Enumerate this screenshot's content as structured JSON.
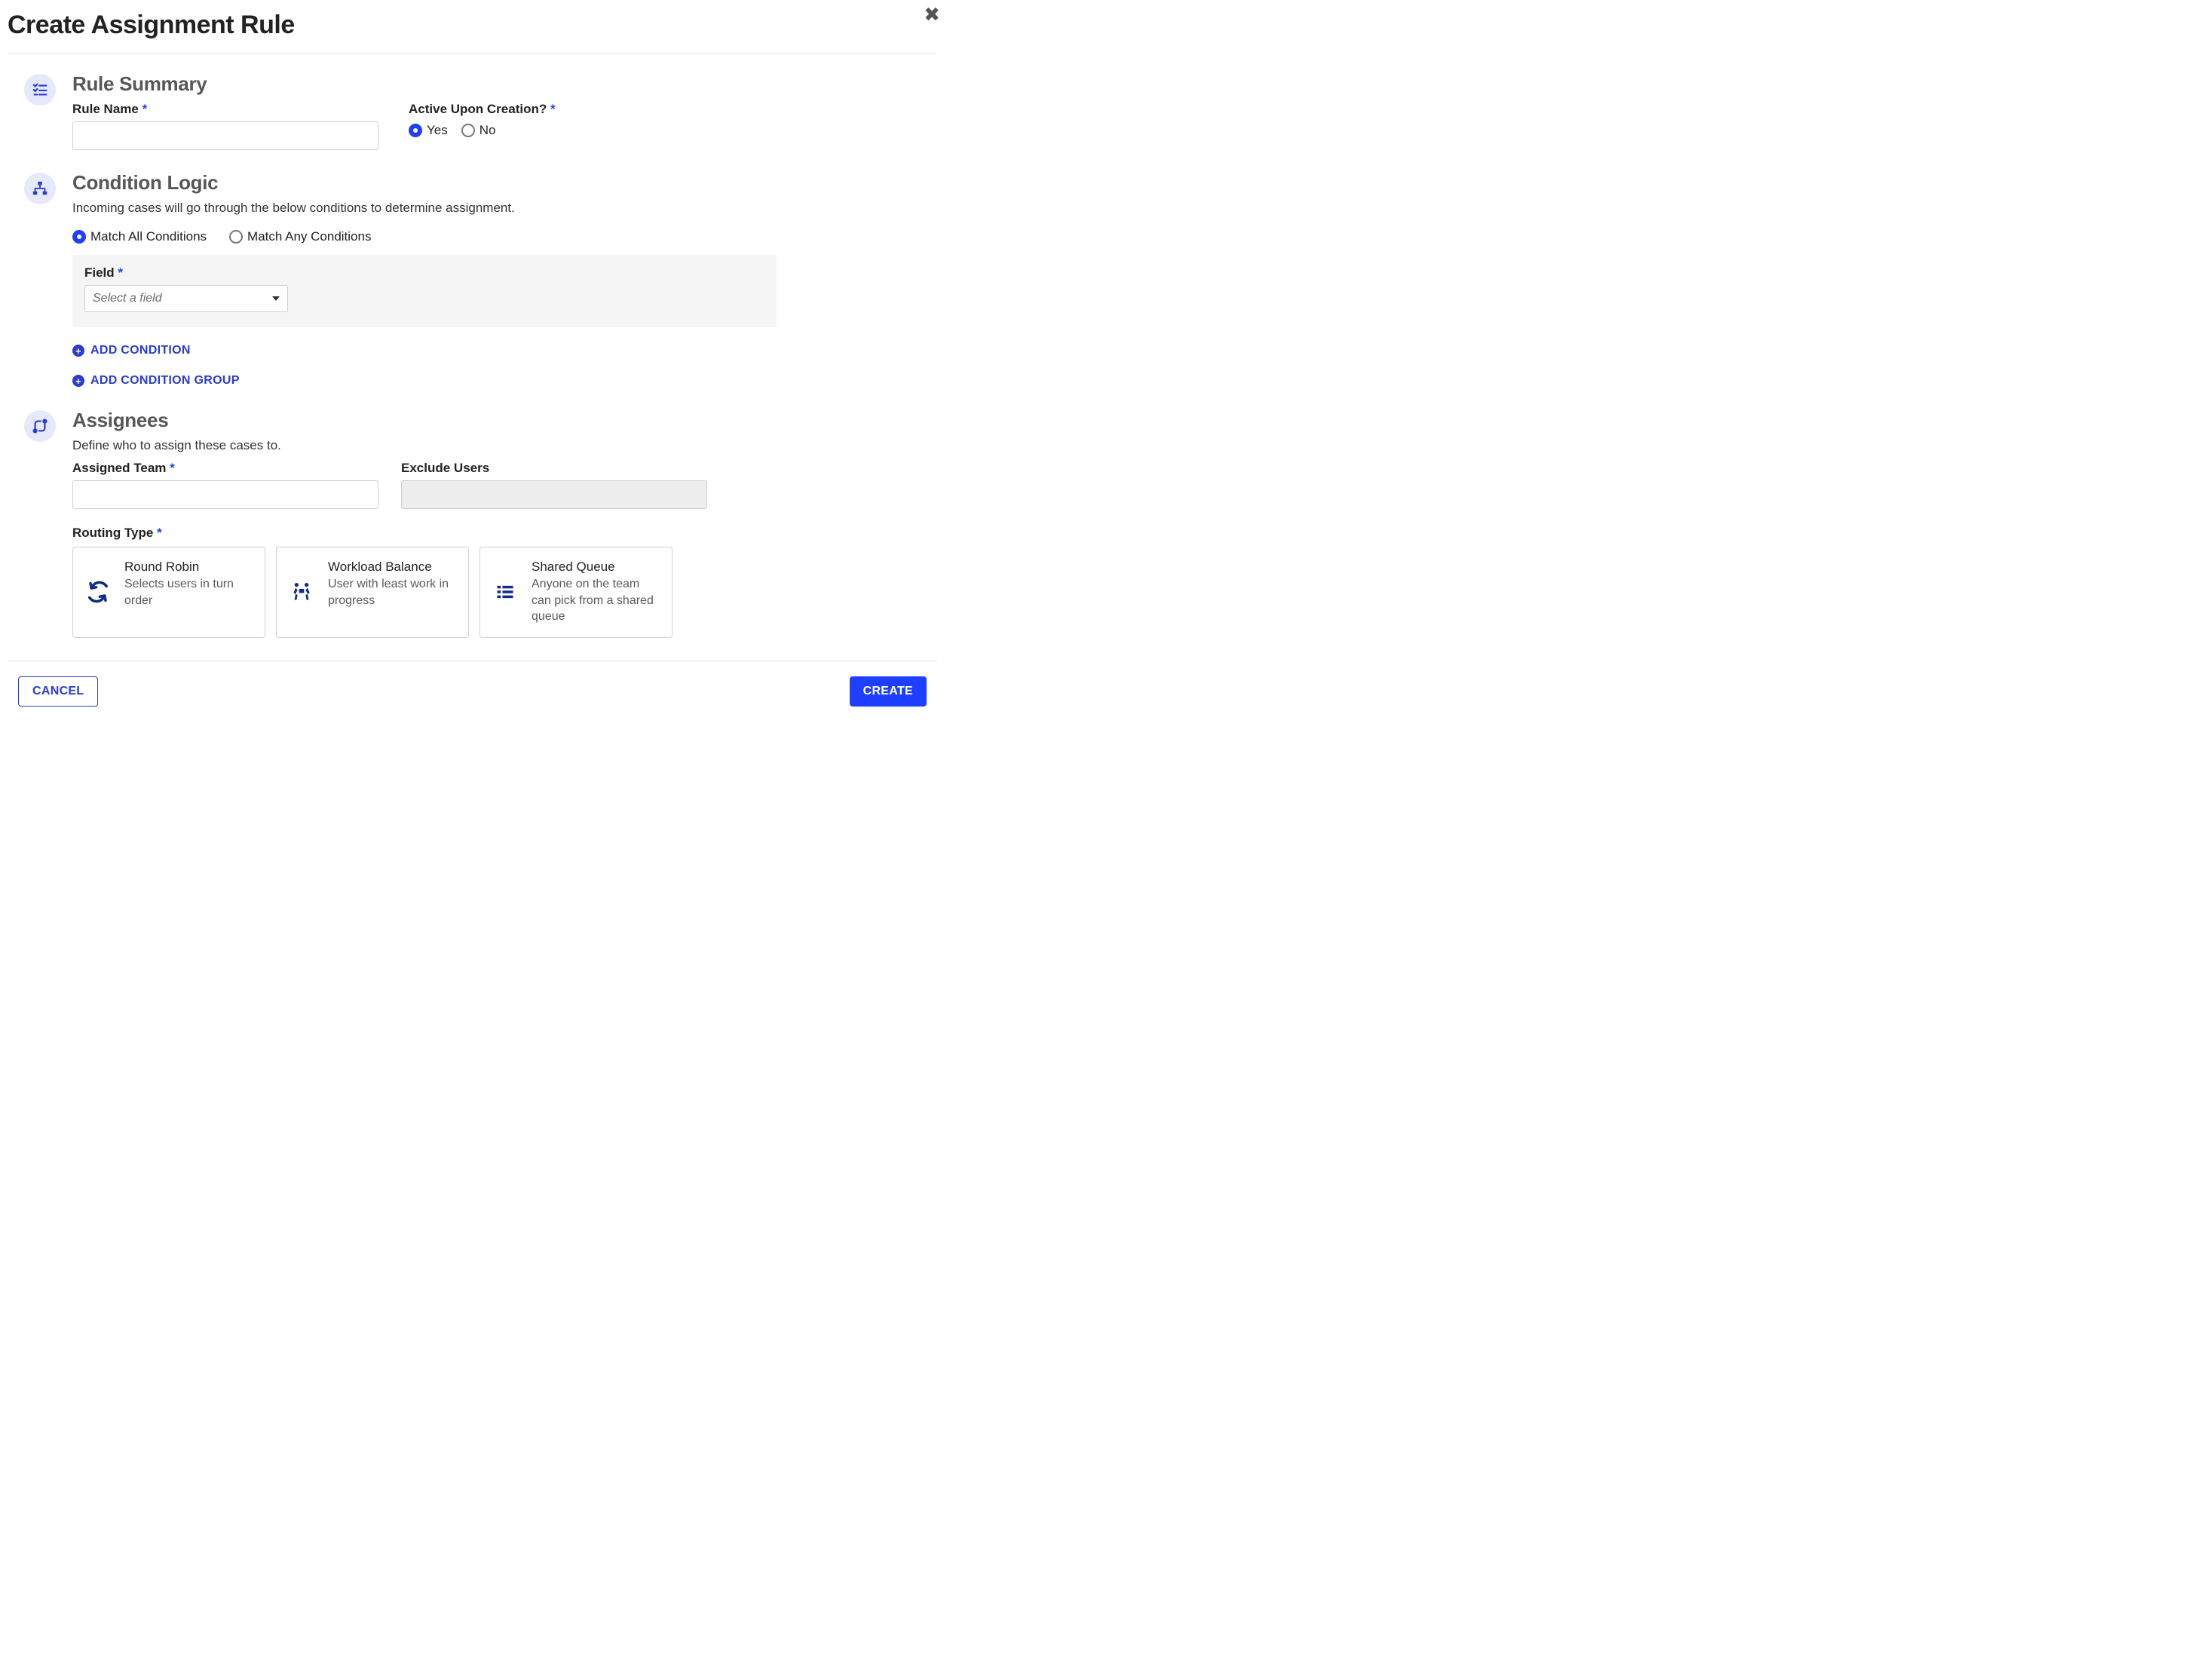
{
  "modal": {
    "title": "Create Assignment Rule"
  },
  "summary": {
    "heading": "Rule Summary",
    "rule_name_label": "Rule Name",
    "rule_name_value": "",
    "active_label": "Active Upon Creation?",
    "active_yes": "Yes",
    "active_no": "No",
    "active_selected": "yes"
  },
  "condition": {
    "heading": "Condition Logic",
    "description": "Incoming cases will go through the below conditions to determine assignment.",
    "match_all": "Match All Conditions",
    "match_any": "Match Any Conditions",
    "match_selected": "all",
    "field_label": "Field",
    "field_placeholder": "Select a field",
    "add_condition": "Add Condition",
    "add_condition_group": "Add Condition Group"
  },
  "assignees": {
    "heading": "Assignees",
    "description": "Define who to assign these cases to.",
    "assigned_team_label": "Assigned Team",
    "assigned_team_value": "",
    "exclude_users_label": "Exclude Users",
    "exclude_users_value": "",
    "routing_type_label": "Routing Type",
    "routing_options": [
      {
        "title": "Round Robin",
        "desc": "Selects users in turn order"
      },
      {
        "title": "Workload Balance",
        "desc": "User with least work in progress"
      },
      {
        "title": "Shared Queue",
        "desc": "Anyone on the team can pick from a shared queue"
      }
    ]
  },
  "footer": {
    "cancel": "Cancel",
    "create": "Create"
  }
}
